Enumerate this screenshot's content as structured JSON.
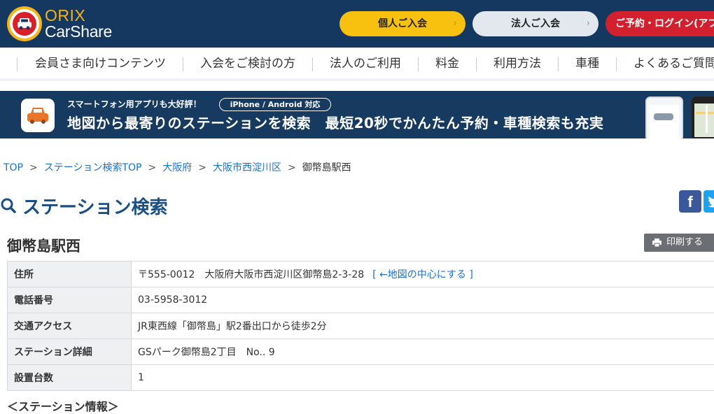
{
  "header": {
    "logo_orix": "ORIX",
    "logo_carshare": "CarShare",
    "btn_personal": "個人ご入会",
    "btn_corporate": "法人ご入会",
    "btn_login": "ご予約・ログイン(アプリ",
    "chevron": "›",
    "colors": {
      "bar": "#14385f",
      "personal": "#f8c00f",
      "corporate": "#e3e8ef",
      "login": "#d3202e"
    }
  },
  "nav": {
    "items": [
      "会員さま向けコンテンツ",
      "入会をご検討の方",
      "法人のご利用",
      "料金",
      "利用方法",
      "車種",
      "よくあるご質問"
    ]
  },
  "banner": {
    "sub": "スマートフォン用アプリも大好評！",
    "pill": "iPhone / Android 対応",
    "main": "地図から最寄りのステーションを検索　最短20秒でかんたん予約・車種検索も充実",
    "icon": "car-icon"
  },
  "breadcrumb": {
    "items": [
      "TOP",
      "ステーション検索TOP",
      "大阪府",
      "大阪市西淀川区"
    ],
    "current": "御幣島駅西",
    "separator": ">"
  },
  "section": {
    "title": "ステーション検索",
    "icon": "search-icon"
  },
  "social": {
    "facebook": "f"
  },
  "station": {
    "name": "御幣島駅西",
    "print_label": "印刷する",
    "rows": [
      {
        "label": "住所",
        "value": "〒555-0012　大阪府大阪市西淀川区御幣島2-3-28",
        "link": "[ ←地図の中心にする ]"
      },
      {
        "label": "電話番号",
        "value": "03-5958-3012"
      },
      {
        "label": "交通アクセス",
        "value": "JR東西線「御幣島」駅2番出口から徒歩2分"
      },
      {
        "label": "ステーション詳細",
        "value": "GSパーク御幣島2丁目　No.. 9"
      },
      {
        "label": "設置台数",
        "value": "1"
      }
    ],
    "info_heading": "＜ステーション情報＞"
  }
}
